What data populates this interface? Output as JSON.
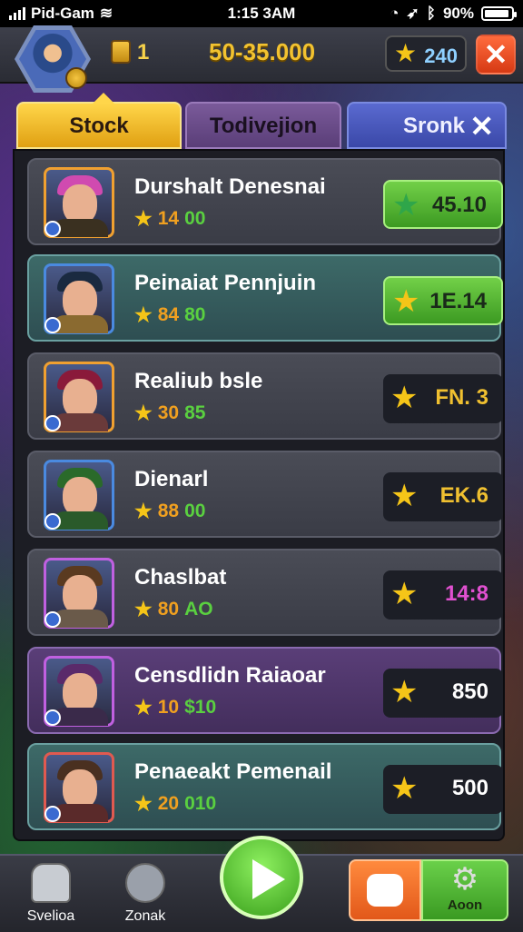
{
  "status_bar": {
    "carrier": "Pid-Gam",
    "time": "1:15 3AM",
    "battery": "90%"
  },
  "header": {
    "level": "1",
    "coins": "50-35.000",
    "stars": "240"
  },
  "tabs": [
    {
      "label": "Stock"
    },
    {
      "label": "Todivejion"
    },
    {
      "label": "Sronk"
    }
  ],
  "items": [
    {
      "name": "Durshalt Denesnai",
      "stat_a": "14",
      "stat_b": "00",
      "price": "45.10",
      "hair": "#d04ab0",
      "body": "#3a3020",
      "frame": "#f0a030",
      "style": "gray",
      "btn": "green"
    },
    {
      "name": "Peinaiat Pennjuin",
      "stat_a": "84",
      "stat_b": "80",
      "price": "1E.14",
      "hair": "#1a2a40",
      "body": "#8a6a30",
      "frame": "#4a8ae0",
      "style": "teal",
      "btn": "green"
    },
    {
      "name": "Realiub bsle",
      "stat_a": "30",
      "stat_b": "85",
      "price": "FN. 3",
      "hair": "#8a1a3a",
      "body": "#6a3a3a",
      "frame": "#f0a030",
      "style": "gray",
      "btn": "dark"
    },
    {
      "name": "Dienarl",
      "stat_a": "88",
      "stat_b": "00",
      "price": "EK.6",
      "hair": "#2a6a2a",
      "body": "#2a5a2a",
      "frame": "#4a8ae0",
      "style": "gray",
      "btn": "dark"
    },
    {
      "name": "Chaslbat",
      "stat_a": "80",
      "stat_b": "AO",
      "price": "14:8",
      "hair": "#5a3a20",
      "body": "#6a5a4a",
      "frame": "#c060e0",
      "style": "gray",
      "btn": "dark"
    },
    {
      "name": "Censdlidn Raiaoar",
      "stat_a": "10",
      "stat_b": "$10",
      "price": "850",
      "hair": "#5a2a6a",
      "body": "#3a2a4a",
      "frame": "#c060e0",
      "style": "purple",
      "btn": "dark"
    },
    {
      "name": "Penaeakt Pemenail",
      "stat_a": "20",
      "stat_b": "010",
      "price": "500",
      "hair": "#4a3020",
      "body": "#5a2a2a",
      "frame": "#e05a50",
      "style": "teal",
      "btn": "dark"
    }
  ],
  "price_colors": [
    "#1a2a1a",
    "#1a2a1a",
    "#f0c030",
    "#f0c030",
    "#e050d0",
    "#ffffff",
    "#ffffff"
  ],
  "bottom_nav": {
    "left1": "Svelioa",
    "left2": "Zonak",
    "settings": "Aoon"
  }
}
